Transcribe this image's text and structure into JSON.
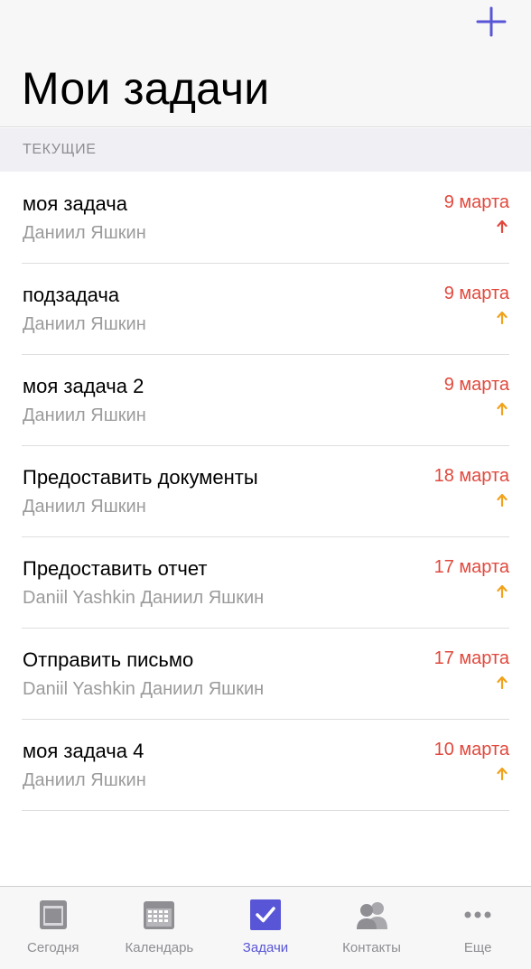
{
  "header": {
    "title": "Мои задачи"
  },
  "colors": {
    "accent": "#5856d6",
    "date": "#e0483c",
    "priority_high": "#e0483c",
    "priority_medium": "#f0a21b"
  },
  "section": {
    "label": "ТЕКУЩИЕ"
  },
  "tasks": [
    {
      "title": "моя задача",
      "assignee": "Даниил Яшкин",
      "date": "9 марта",
      "priority": "high"
    },
    {
      "title": "подзадача",
      "assignee": "Даниил Яшкин",
      "date": "9 марта",
      "priority": "medium"
    },
    {
      "title": "моя задача 2",
      "assignee": "Даниил Яшкин",
      "date": "9 марта",
      "priority": "medium"
    },
    {
      "title": "Предоставить документы",
      "assignee": "Даниил Яшкин",
      "date": "18 марта",
      "priority": "medium"
    },
    {
      "title": "Предоставить отчет",
      "assignee": "Daniil Yashkin Даниил Яшкин",
      "date": "17 марта",
      "priority": "medium"
    },
    {
      "title": "Отправить письмо",
      "assignee": "Daniil Yashkin Даниил Яшкин",
      "date": "17 марта",
      "priority": "medium"
    },
    {
      "title": "моя задача 4",
      "assignee": "Даниил Яшкин",
      "date": "10 марта",
      "priority": "medium"
    }
  ],
  "tabbar": {
    "tabs": [
      {
        "label": "Сегодня",
        "icon": "today-icon",
        "active": false
      },
      {
        "label": "Календарь",
        "icon": "calendar-icon",
        "active": false
      },
      {
        "label": "Задачи",
        "icon": "tasks-checkbox-icon",
        "active": true
      },
      {
        "label": "Контакты",
        "icon": "contacts-icon",
        "active": false
      },
      {
        "label": "Еще",
        "icon": "more-icon",
        "active": false
      }
    ]
  }
}
